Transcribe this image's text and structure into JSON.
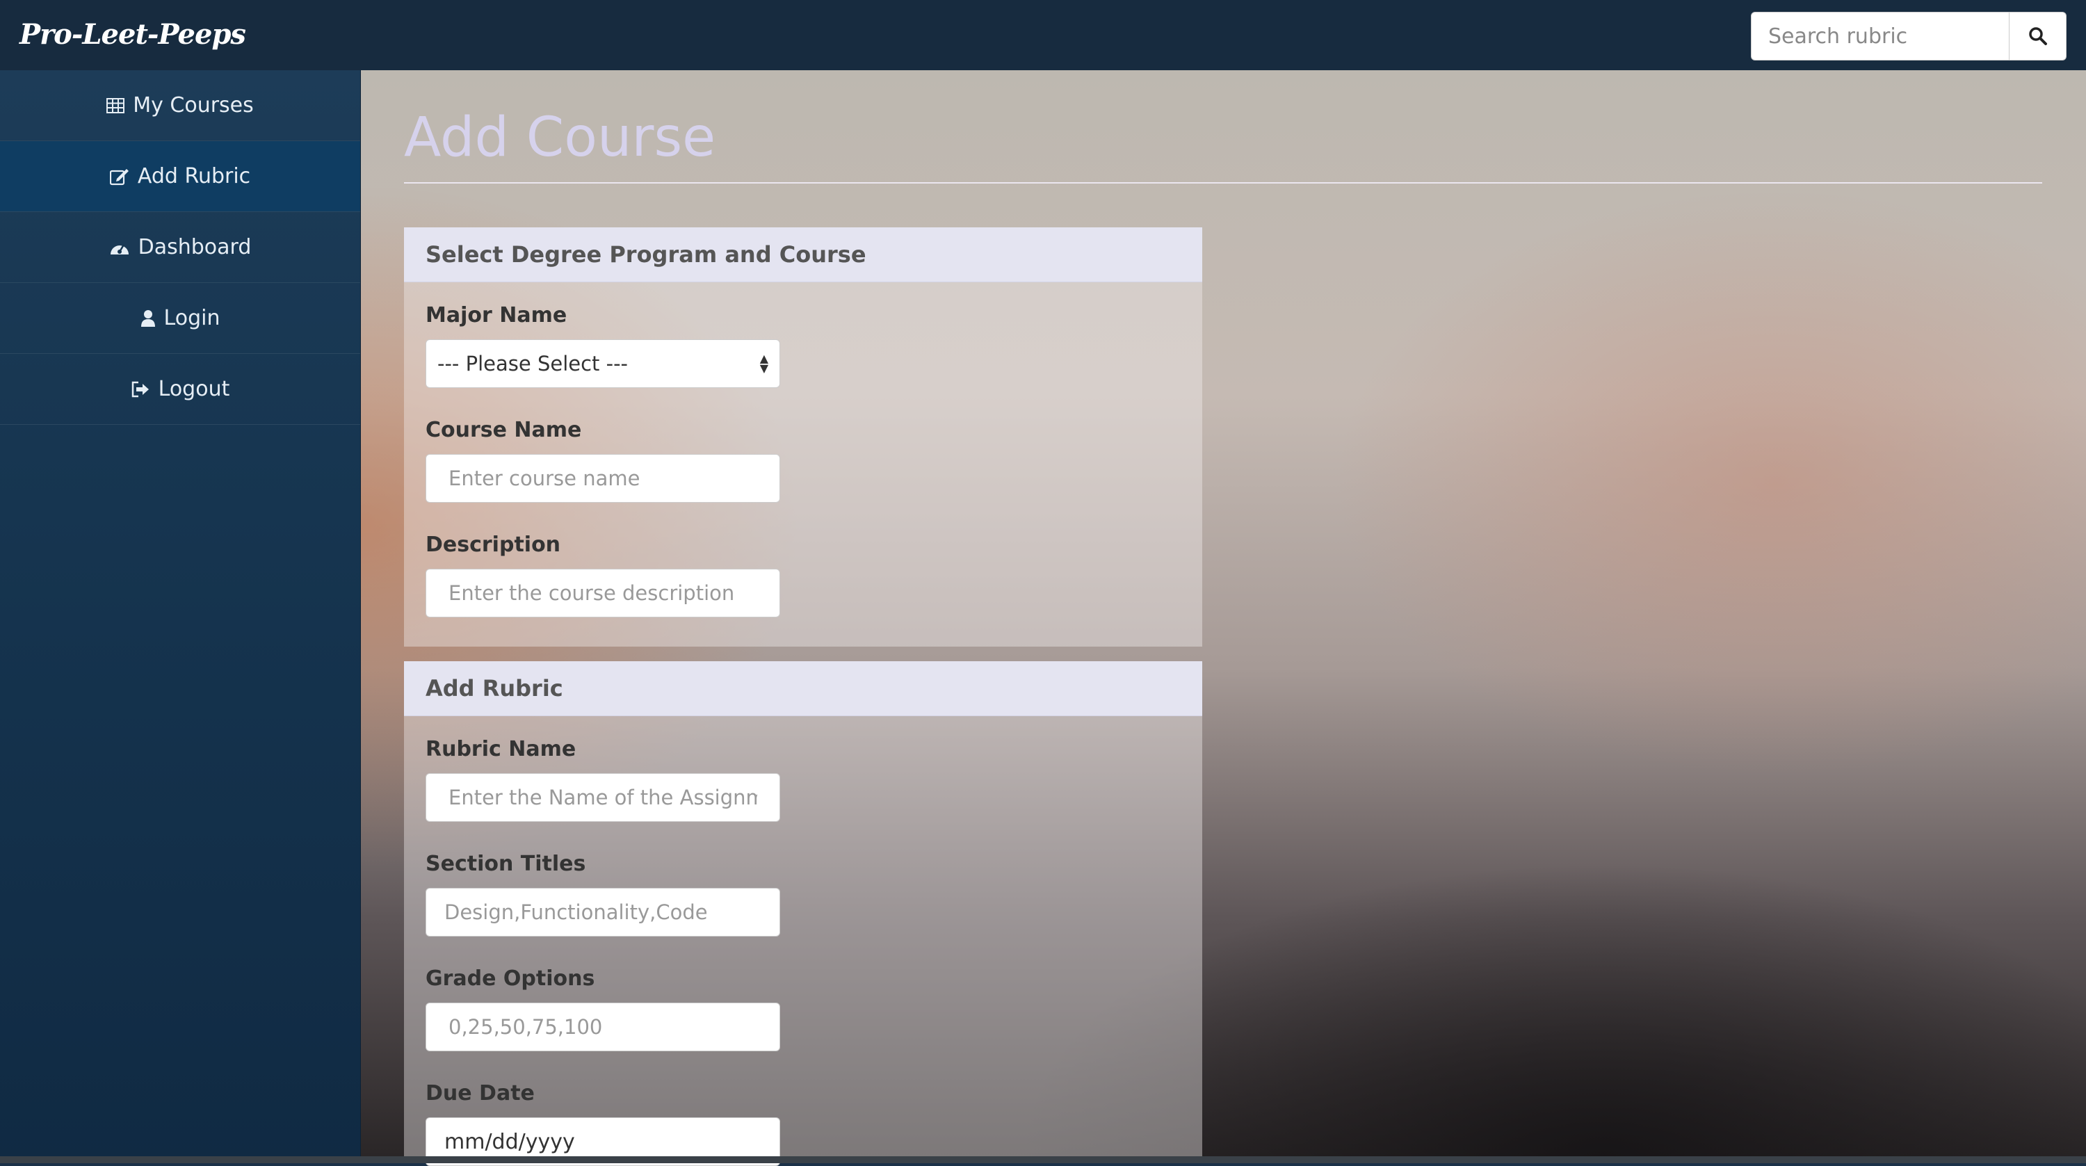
{
  "navbar": {
    "brand": "Pro-Leet-Peeps",
    "search": {
      "placeholder": "Search rubric"
    },
    "search_icon": "search-icon"
  },
  "sidebar": {
    "items": [
      {
        "label": "My Courses",
        "icon": "table-icon",
        "active": false
      },
      {
        "label": "Add Rubric",
        "icon": "edit-icon",
        "active": true
      },
      {
        "label": "Dashboard",
        "icon": "dashboard-icon",
        "active": false
      },
      {
        "label": "Login",
        "icon": "user-icon",
        "active": false
      },
      {
        "label": "Logout",
        "icon": "sign-out-icon",
        "active": false
      }
    ]
  },
  "main": {
    "title": "Add Course",
    "course_panel": {
      "heading": "Select Degree Program and Course",
      "major_label": "Major Name",
      "major_select": "--- Please Select ---",
      "course_label": "Course Name",
      "course_placeholder": "Enter course name",
      "description_label": "Description",
      "description_placeholder": "Enter the course description"
    },
    "rubric_panel": {
      "heading": "Add Rubric",
      "rubric_name_label": "Rubric Name",
      "rubric_name_placeholder": "Enter the Name of the Assignment",
      "section_titles_label": "Section Titles",
      "section_titles_placeholder": "Design,Functionality,Code",
      "grade_options_label": "Grade Options",
      "grade_options_placeholder": "0,25,50,75,100",
      "due_date_label": "Due Date",
      "due_date_value": "mm/dd/yyyy"
    }
  },
  "colors": {
    "navbar": "#172b3f",
    "sidebar": "#163550",
    "sidebar_active": "#0f3d62",
    "title": "#d6d2ec",
    "panel_heading": "#e4e4f1"
  }
}
